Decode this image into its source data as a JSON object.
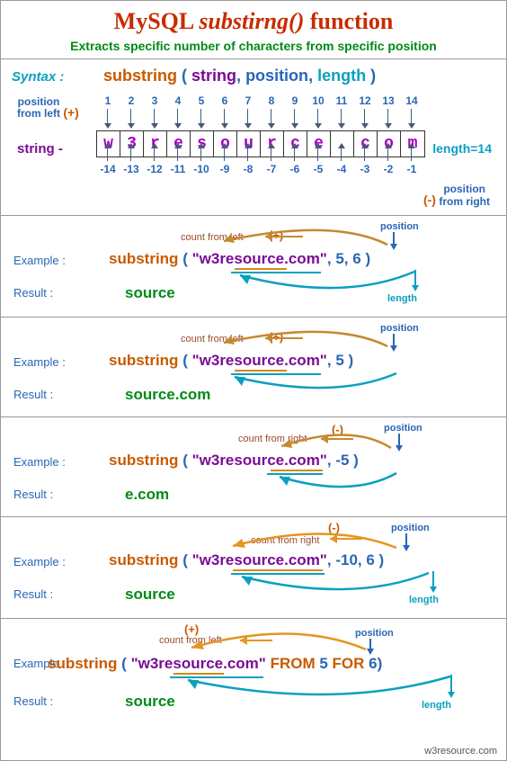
{
  "title": {
    "part1": "MySQL ",
    "part2": "substirng()",
    "part3": " function"
  },
  "subtitle": "Extracts specific number of characters from specific position",
  "syntax": {
    "label": "Syntax :",
    "fn": "substring",
    "open": "(",
    "arg_string": "string",
    "sep": ", ",
    "arg_pos": "position",
    "arg_len": "length",
    "close": ")"
  },
  "diagram": {
    "pos_from_left": "position\nfrom left",
    "pos_from_right": "position\nfrom right",
    "plus": "(+)",
    "minus": "(-)",
    "string_label": "string -",
    "length_label": "length=14",
    "chars": [
      "w",
      "3",
      "r",
      "e",
      "s",
      "o",
      "u",
      "r",
      "c",
      "e",
      ".",
      "c",
      "o",
      "m"
    ],
    "top_nums": [
      "1",
      "2",
      "3",
      "4",
      "5",
      "6",
      "7",
      "8",
      "9",
      "10",
      "11",
      "12",
      "13",
      "14"
    ],
    "bot_nums": [
      "-14",
      "-13",
      "-12",
      "-11",
      "-10",
      "-9",
      "-8",
      "-7",
      "-6",
      "-5",
      "-4",
      "-3",
      "-2",
      "-1"
    ]
  },
  "labels": {
    "example": "Example :",
    "result": "Result :",
    "count_left": "count from left",
    "count_right": "count from right",
    "position": "position",
    "length": "length",
    "plus": "(+)",
    "minus": "(-)"
  },
  "ex": [
    {
      "fn": "substring",
      "open": "( ",
      "str": "\"w3resource.com\"",
      "mid": ", ",
      "pos": "5",
      "mid2": ", ",
      "len": "6",
      "close": " )",
      "result": "source"
    },
    {
      "fn": "substring",
      "open": "( ",
      "str": "\"w3resource.com\"",
      "mid": ", ",
      "pos": "5",
      "close": "   )",
      "result": "source.com"
    },
    {
      "fn": "substring",
      "open": "( ",
      "str": "\"w3resource.com\"",
      "mid": ", ",
      "pos": "-5",
      "close": " )",
      "result": "e.com"
    },
    {
      "fn": "substring",
      "open": "( ",
      "str": "\"w3resource.com\"",
      "mid": ", ",
      "pos": "-10",
      "mid2": ", ",
      "len": "6",
      "close": " )",
      "result": "source"
    },
    {
      "fn": "substring",
      "open": " ( ",
      "str": "\"w3resource.com\"",
      "from": "  FROM  ",
      "pos": "5",
      "for": "  FOR  ",
      "len": "6",
      "close": ")",
      "result": "source"
    }
  ],
  "footer": "w3resource.com"
}
